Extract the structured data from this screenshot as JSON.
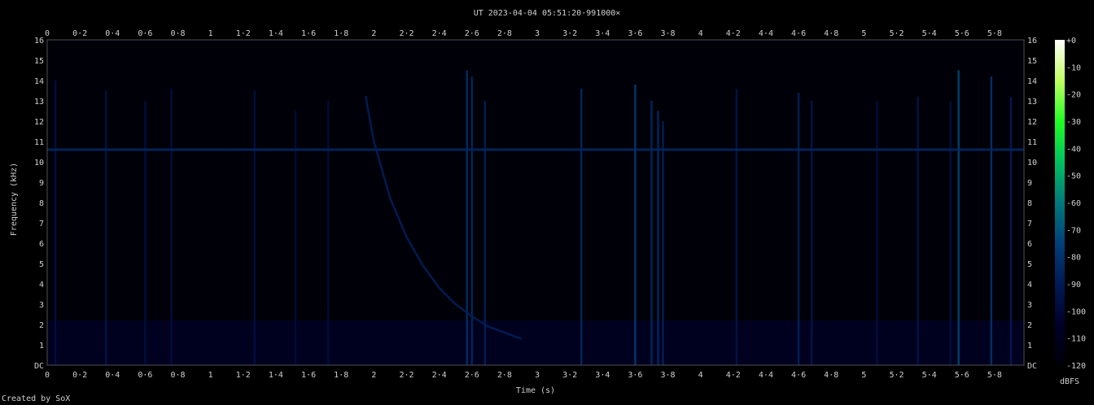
{
  "chart_data": {
    "type": "heatmap",
    "title": "UT 2023-04-04 05:51:20·991000×",
    "xlabel": "Time (s)",
    "ylabel": "Frequency (kHz)",
    "xlim": [
      0,
      5.98
    ],
    "ylim": [
      0,
      16
    ],
    "x_ticks": [
      "0",
      "0·2",
      "0·4",
      "0·6",
      "0·8",
      "1",
      "1·2",
      "1·4",
      "1·6",
      "1·8",
      "2",
      "2·2",
      "2·4",
      "2·6",
      "2·8",
      "3",
      "3·2",
      "3·4",
      "3·6",
      "3·8",
      "4",
      "4·2",
      "4·4",
      "4·6",
      "4·8",
      "5",
      "5·2",
      "5·4",
      "5·6",
      "5·8"
    ],
    "x_tick_values": [
      0,
      0.2,
      0.4,
      0.6,
      0.8,
      1,
      1.2,
      1.4,
      1.6,
      1.8,
      2,
      2.2,
      2.4,
      2.6,
      2.8,
      3,
      3.2,
      3.4,
      3.6,
      3.8,
      4,
      4.2,
      4.4,
      4.6,
      4.8,
      5,
      5.2,
      5.4,
      5.6,
      5.8
    ],
    "y_ticks": [
      "DC",
      "1",
      "2",
      "3",
      "4",
      "5",
      "6",
      "7",
      "8",
      "9",
      "10",
      "11",
      "12",
      "13",
      "14",
      "15",
      "16"
    ],
    "y_tick_values": [
      0,
      1,
      2,
      3,
      4,
      5,
      6,
      7,
      8,
      9,
      10,
      11,
      12,
      13,
      14,
      15,
      16
    ],
    "colorbar": {
      "label": "dBFS",
      "ticks": [
        "+0",
        "-10",
        "-20",
        "-30",
        "-40",
        "-50",
        "-60",
        "-70",
        "-80",
        "-90",
        "-100",
        "-110",
        "-120"
      ],
      "tick_values": [
        0,
        -10,
        -20,
        -30,
        -40,
        -50,
        -60,
        -70,
        -80,
        -90,
        -100,
        -110,
        -120
      ],
      "range": [
        -120,
        0
      ],
      "colors": [
        "#000008",
        "#00002a",
        "#001a55",
        "#00407a",
        "#007a7a",
        "#00c060",
        "#20ff20",
        "#c0ff60",
        "#ffffff"
      ]
    },
    "background_dbfs": -110,
    "tone": {
      "freq_khz": 10.6,
      "dbfs": -85
    },
    "whistler": {
      "description_points_t_s": [
        1.95,
        2.0,
        2.05,
        2.1,
        2.2,
        2.3,
        2.4,
        2.5,
        2.6,
        2.7,
        2.8,
        2.9
      ],
      "freq_khz": [
        13.2,
        11.0,
        9.6,
        8.2,
        6.3,
        4.9,
        3.8,
        3.0,
        2.4,
        1.9,
        1.6,
        1.3
      ],
      "dbfs": -88
    },
    "impulses": [
      {
        "t": 0.05,
        "top_khz": 14.0,
        "dbfs": -95
      },
      {
        "t": 0.36,
        "top_khz": 13.5,
        "dbfs": -93
      },
      {
        "t": 0.6,
        "top_khz": 13.0,
        "dbfs": -96
      },
      {
        "t": 0.76,
        "top_khz": 13.6,
        "dbfs": -95
      },
      {
        "t": 1.27,
        "top_khz": 13.5,
        "dbfs": -95
      },
      {
        "t": 1.52,
        "top_khz": 12.5,
        "dbfs": -98
      },
      {
        "t": 1.72,
        "top_khz": 13.0,
        "dbfs": -97
      },
      {
        "t": 2.57,
        "top_khz": 14.5,
        "dbfs": -80
      },
      {
        "t": 2.6,
        "top_khz": 14.2,
        "dbfs": -82
      },
      {
        "t": 2.68,
        "top_khz": 13.0,
        "dbfs": -86
      },
      {
        "t": 3.27,
        "top_khz": 13.6,
        "dbfs": -82
      },
      {
        "t": 3.6,
        "top_khz": 13.8,
        "dbfs": -75
      },
      {
        "t": 3.7,
        "top_khz": 13.0,
        "dbfs": -82
      },
      {
        "t": 3.74,
        "top_khz": 12.5,
        "dbfs": -82
      },
      {
        "t": 3.77,
        "top_khz": 12.0,
        "dbfs": -85
      },
      {
        "t": 4.22,
        "top_khz": 13.6,
        "dbfs": -92
      },
      {
        "t": 4.6,
        "top_khz": 13.4,
        "dbfs": -85
      },
      {
        "t": 4.68,
        "top_khz": 13.0,
        "dbfs": -90
      },
      {
        "t": 5.08,
        "top_khz": 13.0,
        "dbfs": -96
      },
      {
        "t": 5.33,
        "top_khz": 13.2,
        "dbfs": -92
      },
      {
        "t": 5.53,
        "top_khz": 13.0,
        "dbfs": -96
      },
      {
        "t": 5.58,
        "top_khz": 14.5,
        "dbfs": -72
      },
      {
        "t": 5.78,
        "top_khz": 14.2,
        "dbfs": -78
      },
      {
        "t": 5.9,
        "top_khz": 13.2,
        "dbfs": -88
      }
    ]
  },
  "credit": "Created by SoX"
}
